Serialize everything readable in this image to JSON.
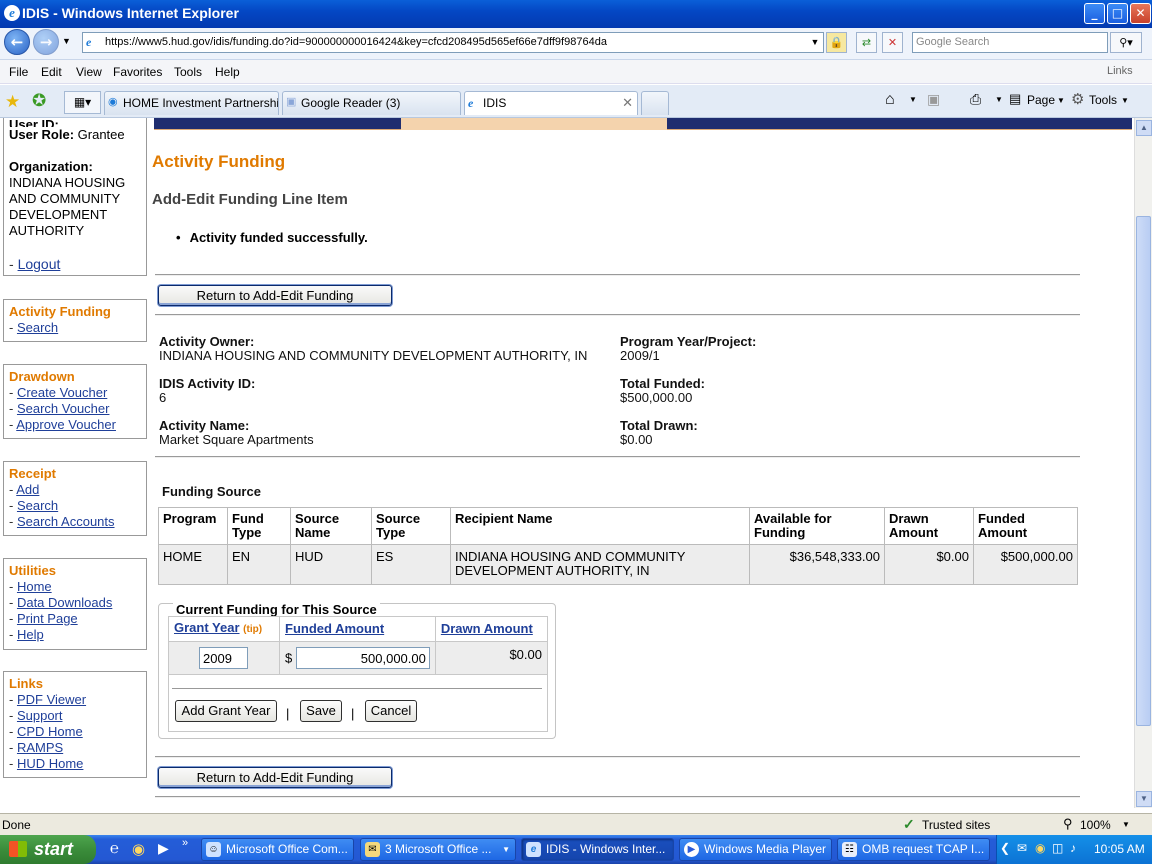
{
  "window": {
    "title": "IDIS - Windows Internet Explorer",
    "minimize": "_",
    "maximize": "□",
    "close": "✕"
  },
  "addressbar": {
    "url": "https://www5.hud.gov/idis/funding.do?id=900000000016424&key=cfcd208495d565ef66e7dff9f98764da",
    "search_placeholder": "Google Search"
  },
  "menu": [
    "File",
    "Edit",
    "View",
    "Favorites",
    "Tools",
    "Help"
  ],
  "menu_links": "Links",
  "tabs": [
    {
      "label": "HOME Investment Partnershi...",
      "active": false
    },
    {
      "label": "Google Reader (3)",
      "active": false
    },
    {
      "label": "IDIS",
      "active": true
    }
  ],
  "toolbar": {
    "page": "Page",
    "tools": "Tools"
  },
  "user": {
    "id_partial": "User ID: ...",
    "role_label": "User Role:",
    "role": "Grantee",
    "org_label": "Organization:",
    "org_lines": [
      "INDIANA HOUSING",
      "AND COMMUNITY",
      "DEVELOPMENT",
      "AUTHORITY"
    ],
    "logout": "Logout"
  },
  "sidebar": {
    "activity_funding": {
      "heading": "Activity Funding",
      "items": [
        "Search"
      ]
    },
    "drawdown": {
      "heading": "Drawdown",
      "items": [
        "Create Voucher",
        "Search Voucher",
        "Approve Voucher"
      ]
    },
    "receipt": {
      "heading": "Receipt",
      "items": [
        "Add",
        "Search",
        "Search Accounts"
      ]
    },
    "utilities": {
      "heading": "Utilities",
      "items": [
        "Home",
        "Data Downloads",
        "Print Page",
        "Help"
      ]
    },
    "links": {
      "heading": "Links",
      "items": [
        "PDF Viewer",
        "Support",
        "CPD Home",
        "RAMPS",
        "HUD Home"
      ]
    }
  },
  "page": {
    "title": "Activity Funding",
    "subtitle": "Add-Edit Funding Line Item",
    "message": "Activity funded successfully.",
    "return_button": "Return to Add-Edit Funding"
  },
  "details": {
    "activity_owner_label": "Activity Owner:",
    "activity_owner": "INDIANA HOUSING AND COMMUNITY DEVELOPMENT AUTHORITY, IN",
    "program_year_label": "Program Year/Project:",
    "program_year": "2009/1",
    "activity_id_label": "IDIS Activity ID:",
    "activity_id": "6",
    "total_funded_label": "Total Funded:",
    "total_funded": "$500,000.00",
    "activity_name_label": "Activity Name:",
    "activity_name": "Market Square Apartments",
    "total_drawn_label": "Total Drawn:",
    "total_drawn": "$0.00"
  },
  "funding_source": {
    "heading": "Funding Source",
    "columns": [
      "Program",
      "Fund Type",
      "Source Name",
      "Source Type",
      "Recipient Name",
      "Available for Funding",
      "Drawn Amount",
      "Funded Amount"
    ],
    "row": [
      "HOME",
      "EN",
      "HUD",
      "ES",
      "INDIANA HOUSING AND COMMUNITY DEVELOPMENT AUTHORITY, IN",
      "$36,548,333.00",
      "$0.00",
      "$500,000.00"
    ]
  },
  "current_funding": {
    "legend": "Current Funding for This Source",
    "col_grant_year": "Grant Year",
    "tip": "(tip)",
    "col_funded_amount": "Funded Amount",
    "col_drawn_amount": "Drawn Amount",
    "grant_year": "2009",
    "currency": "$",
    "funded_amount": "500,000.00",
    "drawn_amount": "$0.00",
    "buttons": {
      "add": "Add Grant Year",
      "save": "Save",
      "cancel": "Cancel"
    },
    "divider": "|"
  },
  "status": {
    "text": "Done",
    "zone": "Trusted sites",
    "zoom": "100%"
  },
  "taskbar": {
    "start": "start",
    "items": [
      {
        "label": "Microsoft Office Com...",
        "active": false
      },
      {
        "label": "3 Microsoft Office ...",
        "active": false
      },
      {
        "label": "IDIS - Windows Inter...",
        "active": true
      },
      {
        "label": "Windows Media Player",
        "active": false
      },
      {
        "label": "OMB request TCAP I...",
        "active": false
      }
    ],
    "clock": "10:05 AM"
  }
}
